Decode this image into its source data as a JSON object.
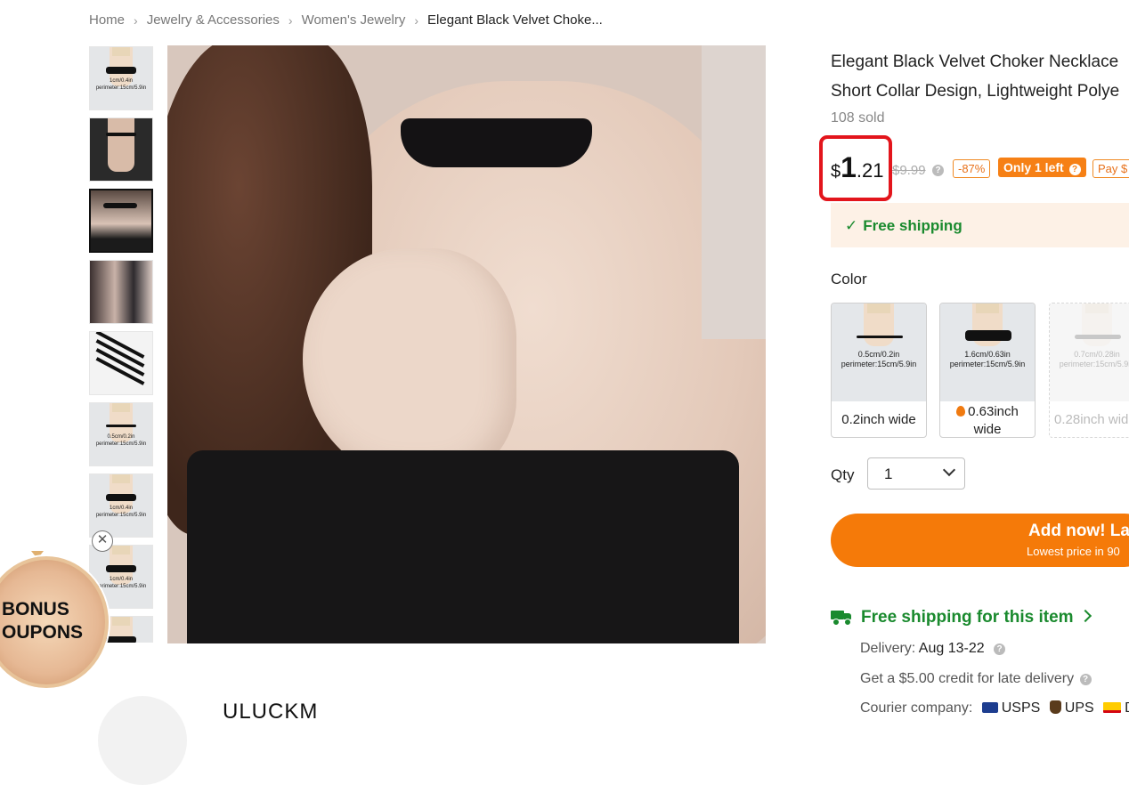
{
  "breadcrumb": {
    "items": [
      "Home",
      "Jewelry & Accessories",
      "Women's Jewelry"
    ],
    "current": "Elegant Black Velvet Choke...",
    "separator": "›"
  },
  "thumbnails": {
    "captions": [
      [
        "1cm/0.4in",
        "perimeter:15cm/5.9in"
      ],
      [
        "0.5cm/0.2in",
        "perimeter:15cm/5.9in"
      ],
      [
        "1cm/0.4in",
        "perimeter:15cm/5.9in"
      ],
      [
        "1cm/0.4in",
        "perimeter:15cm/5.9in"
      ]
    ],
    "active_index": 2
  },
  "bonus": {
    "line1": "BONUS",
    "line2": "OUPONS",
    "close_symbol": "✕"
  },
  "store": {
    "name": "ULUCKM"
  },
  "product": {
    "title_line1": "Elegant Black Velvet Choker Necklace",
    "title_line2": "Short Collar Design, Lightweight Polye",
    "sold": "108 sold",
    "price_currency": "$",
    "price_int": "1",
    "price_cents": ".21",
    "original_price": "$9.99",
    "discount": "-87%",
    "stock_badge": "Only 1 left",
    "pay_badge": "Pay $",
    "help_symbol": "?"
  },
  "shipping_banner": {
    "check": "✓",
    "text": "Free shipping"
  },
  "color": {
    "label": "Color",
    "options": [
      {
        "label": "0.2inch wide",
        "cap1": "0.5cm/0.2in",
        "cap2": "perimeter:15cm/5.9in",
        "state": "available"
      },
      {
        "label1": "0.63inch",
        "label2": "wide",
        "cap1": "1.6cm/0.63in",
        "cap2": "perimeter:15cm/5.9in",
        "state": "selected-hot"
      },
      {
        "label": "0.28inch wid",
        "cap1": "0.7cm/0.28in",
        "cap2": "perimeter:15cm/5.9in",
        "state": "disabled"
      }
    ]
  },
  "quantity": {
    "label": "Qty",
    "value": "1"
  },
  "add_button": {
    "label": "Add now! La",
    "sub": "Lowest price in 90"
  },
  "delivery": {
    "free_shipping_link": "Free shipping for this item",
    "delivery_label": "Delivery:",
    "delivery_value": "Aug 13-22",
    "credit_text": "Get a $5.00 credit for late delivery",
    "courier_label": "Courier company:",
    "couriers": [
      "USPS",
      "UPS",
      "D"
    ]
  },
  "colors": {
    "accent_orange": "#f57a09",
    "price_box_red": "#e3151c",
    "success_green": "#1a8a2e",
    "banner_bg": "#fdf1e6"
  }
}
